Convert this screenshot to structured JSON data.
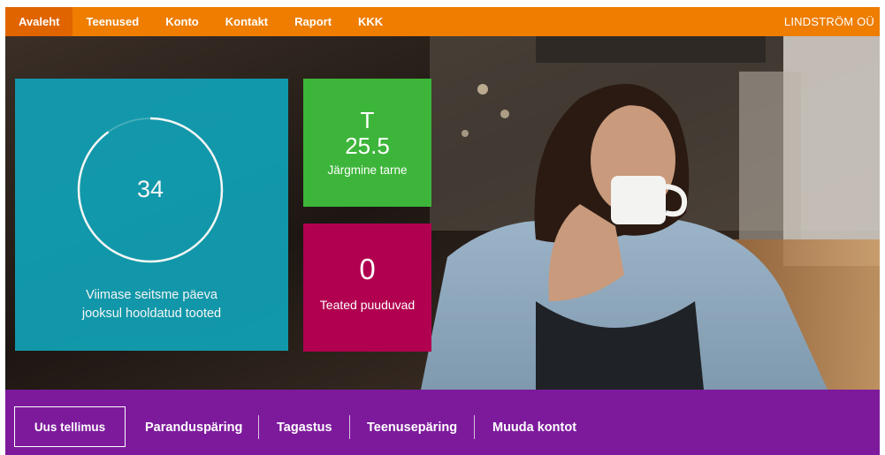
{
  "nav": {
    "items": [
      {
        "label": "Avaleht",
        "active": true
      },
      {
        "label": "Teenused",
        "active": false
      },
      {
        "label": "Konto",
        "active": false
      },
      {
        "label": "Kontakt",
        "active": false
      },
      {
        "label": "Raport",
        "active": false
      },
      {
        "label": "KKK",
        "active": false
      }
    ],
    "company": "LINDSTRÖM OÜ"
  },
  "hero": {
    "image": "woman-drinking-coffee-photo"
  },
  "tiles": {
    "serviced": {
      "value": "34",
      "caption_line1": "Viimase seitsme päeva",
      "caption_line2": "jooksul hooldatud tooted",
      "ring_progress": 0.9,
      "color": "#119db0"
    },
    "delivery": {
      "letter": "T",
      "value": "25.5",
      "label": "Järgmine tarne",
      "color": "#3db53a"
    },
    "notifications": {
      "value": "0",
      "label": "Teated puuduvad",
      "color": "#b1004f"
    }
  },
  "actions": {
    "new_order": "Uus tellimus",
    "repair": "Paranduspäring",
    "return": "Tagastus",
    "service": "Teenusepäring",
    "edit_account": "Muuda kontot"
  },
  "colors": {
    "nav_bg": "#ee7d00",
    "action_bar_bg": "#7d1a9c"
  }
}
